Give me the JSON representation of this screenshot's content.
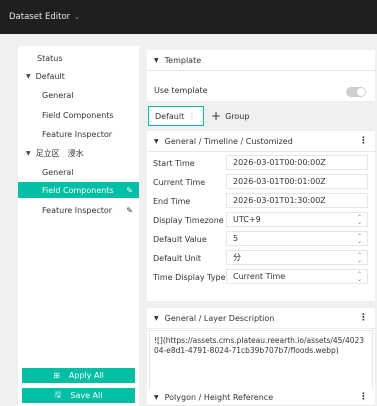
{
  "titlebar": {
    "title": "Dataset Editor",
    "chevron_icon": "chevron-down-icon"
  },
  "sidebar": {
    "items": [
      {
        "label": "Status"
      },
      {
        "label": "Default"
      },
      {
        "label": "General"
      },
      {
        "label": "Field Components"
      },
      {
        "label": "Feature Inspector"
      },
      {
        "label": "足立区　浸水"
      },
      {
        "label": "General"
      },
      {
        "label": "Field Components"
      },
      {
        "label": "Feature Inspector"
      }
    ],
    "apply_all_label": "Apply All",
    "save_all_label": "Save All"
  },
  "template": {
    "title": "Template",
    "use_template_label": "Use template",
    "use_template_enabled": false
  },
  "tabs": {
    "default_label": "Default",
    "group_label": "Group"
  },
  "timeline": {
    "title": "General / Timeline / Customized",
    "fields": [
      {
        "label": "Start Time",
        "value": "2026-03-01T00:00:00Z"
      },
      {
        "label": "Current Time",
        "value": "2026-03-01T00:01:00Z"
      },
      {
        "label": "End Time",
        "value": "2026-03-01T01:30:00Z"
      },
      {
        "label": "Display Timezone",
        "value": "UTC+9"
      },
      {
        "label": "Default Value",
        "value": "5"
      },
      {
        "label": "Default Unit",
        "value": "分"
      },
      {
        "label": "Time Display Type",
        "value": "Current Time"
      }
    ]
  },
  "layer_description": {
    "title": "General / Layer Description",
    "text": "![](https://assets.cms.plateau.reearth.io/assets/45/402304-e8d1-4791-8024-71cb39b707b7/floods.webp)"
  },
  "polygon": {
    "title": "Polygon / Height Reference"
  },
  "colors": {
    "accent": "#00bfa5",
    "titlebar": "#1f1f1f"
  }
}
